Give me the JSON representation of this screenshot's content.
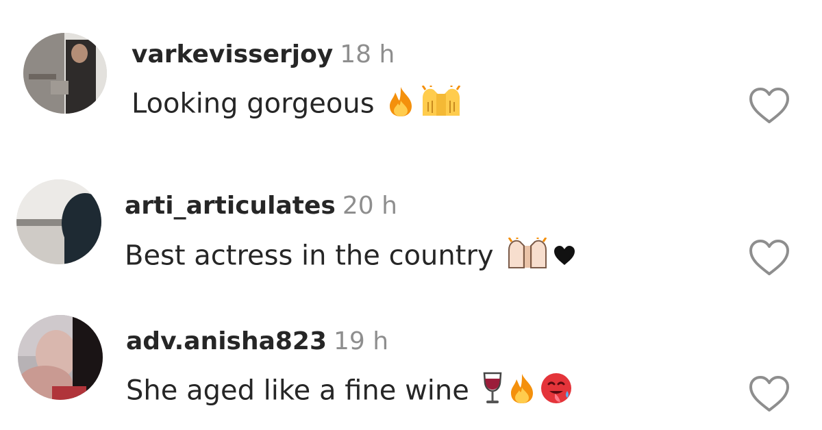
{
  "comments": [
    {
      "username": "varkevisserjoy",
      "time": "18 h",
      "text": "Looking gorgeous",
      "emojis": [
        "fire-emoji",
        "raising-hands-emoji"
      ],
      "like_icon": "heart-outline-icon"
    },
    {
      "username": "arti_articulates",
      "time": "20 h",
      "text": "Best actress in the country",
      "emojis": [
        "raising-hands-light-emoji",
        "black-heart-emoji"
      ],
      "like_icon": "heart-outline-icon"
    },
    {
      "username": "adv.anisha823",
      "time": "19 h",
      "text": "She aged like a fine wine",
      "emojis": [
        "wine-glass-emoji",
        "fire-emoji",
        "hot-face-emoji"
      ],
      "like_icon": "heart-outline-icon"
    }
  ],
  "colors": {
    "username": "#262626",
    "time": "#8e8e8e",
    "heart_outline": "#262626"
  }
}
